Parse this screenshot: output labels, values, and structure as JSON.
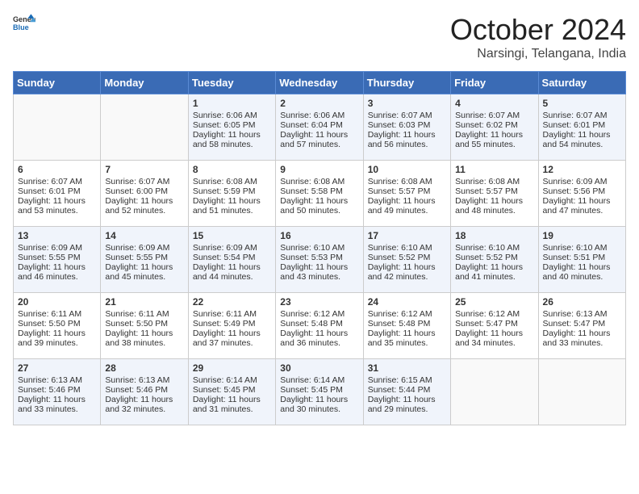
{
  "header": {
    "logo_general": "General",
    "logo_blue": "Blue",
    "title": "October 2024",
    "subtitle": "Narsingi, Telangana, India"
  },
  "weekdays": [
    "Sunday",
    "Monday",
    "Tuesday",
    "Wednesday",
    "Thursday",
    "Friday",
    "Saturday"
  ],
  "weeks": [
    [
      {
        "day": "",
        "sunrise": "",
        "sunset": "",
        "daylight": ""
      },
      {
        "day": "",
        "sunrise": "",
        "sunset": "",
        "daylight": ""
      },
      {
        "day": "1",
        "sunrise": "Sunrise: 6:06 AM",
        "sunset": "Sunset: 6:05 PM",
        "daylight": "Daylight: 11 hours and 58 minutes."
      },
      {
        "day": "2",
        "sunrise": "Sunrise: 6:06 AM",
        "sunset": "Sunset: 6:04 PM",
        "daylight": "Daylight: 11 hours and 57 minutes."
      },
      {
        "day": "3",
        "sunrise": "Sunrise: 6:07 AM",
        "sunset": "Sunset: 6:03 PM",
        "daylight": "Daylight: 11 hours and 56 minutes."
      },
      {
        "day": "4",
        "sunrise": "Sunrise: 6:07 AM",
        "sunset": "Sunset: 6:02 PM",
        "daylight": "Daylight: 11 hours and 55 minutes."
      },
      {
        "day": "5",
        "sunrise": "Sunrise: 6:07 AM",
        "sunset": "Sunset: 6:01 PM",
        "daylight": "Daylight: 11 hours and 54 minutes."
      }
    ],
    [
      {
        "day": "6",
        "sunrise": "Sunrise: 6:07 AM",
        "sunset": "Sunset: 6:01 PM",
        "daylight": "Daylight: 11 hours and 53 minutes."
      },
      {
        "day": "7",
        "sunrise": "Sunrise: 6:07 AM",
        "sunset": "Sunset: 6:00 PM",
        "daylight": "Daylight: 11 hours and 52 minutes."
      },
      {
        "day": "8",
        "sunrise": "Sunrise: 6:08 AM",
        "sunset": "Sunset: 5:59 PM",
        "daylight": "Daylight: 11 hours and 51 minutes."
      },
      {
        "day": "9",
        "sunrise": "Sunrise: 6:08 AM",
        "sunset": "Sunset: 5:58 PM",
        "daylight": "Daylight: 11 hours and 50 minutes."
      },
      {
        "day": "10",
        "sunrise": "Sunrise: 6:08 AM",
        "sunset": "Sunset: 5:57 PM",
        "daylight": "Daylight: 11 hours and 49 minutes."
      },
      {
        "day": "11",
        "sunrise": "Sunrise: 6:08 AM",
        "sunset": "Sunset: 5:57 PM",
        "daylight": "Daylight: 11 hours and 48 minutes."
      },
      {
        "day": "12",
        "sunrise": "Sunrise: 6:09 AM",
        "sunset": "Sunset: 5:56 PM",
        "daylight": "Daylight: 11 hours and 47 minutes."
      }
    ],
    [
      {
        "day": "13",
        "sunrise": "Sunrise: 6:09 AM",
        "sunset": "Sunset: 5:55 PM",
        "daylight": "Daylight: 11 hours and 46 minutes."
      },
      {
        "day": "14",
        "sunrise": "Sunrise: 6:09 AM",
        "sunset": "Sunset: 5:55 PM",
        "daylight": "Daylight: 11 hours and 45 minutes."
      },
      {
        "day": "15",
        "sunrise": "Sunrise: 6:09 AM",
        "sunset": "Sunset: 5:54 PM",
        "daylight": "Daylight: 11 hours and 44 minutes."
      },
      {
        "day": "16",
        "sunrise": "Sunrise: 6:10 AM",
        "sunset": "Sunset: 5:53 PM",
        "daylight": "Daylight: 11 hours and 43 minutes."
      },
      {
        "day": "17",
        "sunrise": "Sunrise: 6:10 AM",
        "sunset": "Sunset: 5:52 PM",
        "daylight": "Daylight: 11 hours and 42 minutes."
      },
      {
        "day": "18",
        "sunrise": "Sunrise: 6:10 AM",
        "sunset": "Sunset: 5:52 PM",
        "daylight": "Daylight: 11 hours and 41 minutes."
      },
      {
        "day": "19",
        "sunrise": "Sunrise: 6:10 AM",
        "sunset": "Sunset: 5:51 PM",
        "daylight": "Daylight: 11 hours and 40 minutes."
      }
    ],
    [
      {
        "day": "20",
        "sunrise": "Sunrise: 6:11 AM",
        "sunset": "Sunset: 5:50 PM",
        "daylight": "Daylight: 11 hours and 39 minutes."
      },
      {
        "day": "21",
        "sunrise": "Sunrise: 6:11 AM",
        "sunset": "Sunset: 5:50 PM",
        "daylight": "Daylight: 11 hours and 38 minutes."
      },
      {
        "day": "22",
        "sunrise": "Sunrise: 6:11 AM",
        "sunset": "Sunset: 5:49 PM",
        "daylight": "Daylight: 11 hours and 37 minutes."
      },
      {
        "day": "23",
        "sunrise": "Sunrise: 6:12 AM",
        "sunset": "Sunset: 5:48 PM",
        "daylight": "Daylight: 11 hours and 36 minutes."
      },
      {
        "day": "24",
        "sunrise": "Sunrise: 6:12 AM",
        "sunset": "Sunset: 5:48 PM",
        "daylight": "Daylight: 11 hours and 35 minutes."
      },
      {
        "day": "25",
        "sunrise": "Sunrise: 6:12 AM",
        "sunset": "Sunset: 5:47 PM",
        "daylight": "Daylight: 11 hours and 34 minutes."
      },
      {
        "day": "26",
        "sunrise": "Sunrise: 6:13 AM",
        "sunset": "Sunset: 5:47 PM",
        "daylight": "Daylight: 11 hours and 33 minutes."
      }
    ],
    [
      {
        "day": "27",
        "sunrise": "Sunrise: 6:13 AM",
        "sunset": "Sunset: 5:46 PM",
        "daylight": "Daylight: 11 hours and 33 minutes."
      },
      {
        "day": "28",
        "sunrise": "Sunrise: 6:13 AM",
        "sunset": "Sunset: 5:46 PM",
        "daylight": "Daylight: 11 hours and 32 minutes."
      },
      {
        "day": "29",
        "sunrise": "Sunrise: 6:14 AM",
        "sunset": "Sunset: 5:45 PM",
        "daylight": "Daylight: 11 hours and 31 minutes."
      },
      {
        "day": "30",
        "sunrise": "Sunrise: 6:14 AM",
        "sunset": "Sunset: 5:45 PM",
        "daylight": "Daylight: 11 hours and 30 minutes."
      },
      {
        "day": "31",
        "sunrise": "Sunrise: 6:15 AM",
        "sunset": "Sunset: 5:44 PM",
        "daylight": "Daylight: 11 hours and 29 minutes."
      },
      {
        "day": "",
        "sunrise": "",
        "sunset": "",
        "daylight": ""
      },
      {
        "day": "",
        "sunrise": "",
        "sunset": "",
        "daylight": ""
      }
    ]
  ]
}
